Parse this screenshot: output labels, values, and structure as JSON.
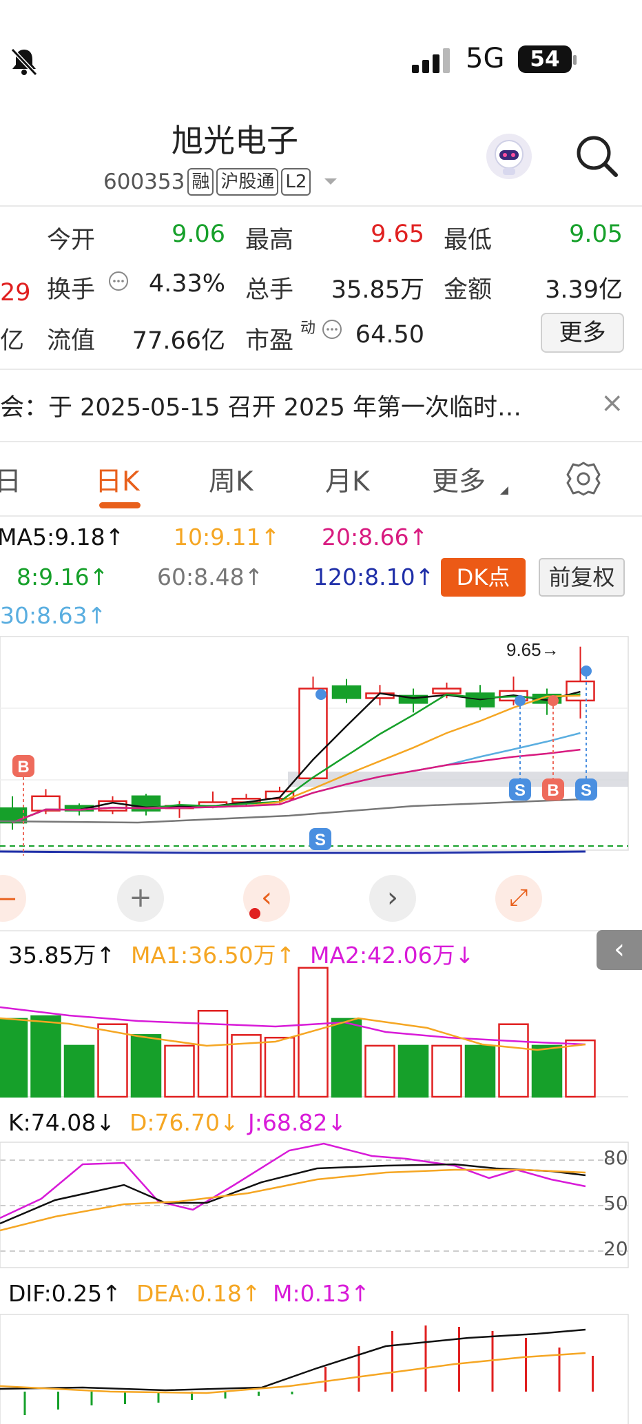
{
  "status": {
    "network": "5G",
    "battery": "54",
    "icons": [
      "bell-off-icon",
      "signal-icon"
    ]
  },
  "header": {
    "title": "旭光电子",
    "code": "600353",
    "tags": [
      "融",
      "沪股通",
      "L2"
    ],
    "icons": [
      "robot-avatar-icon",
      "search-icon",
      "dropdown-triangle-icon"
    ]
  },
  "quote": {
    "open_label": "今开",
    "open": "9.06",
    "high_label": "最高",
    "high": "9.65",
    "low_label": "最低",
    "low": "9.05",
    "turnover_label": "换手",
    "turnover": "4.33%",
    "volume_label": "总手",
    "volume": "35.85万",
    "amount_label": "金额",
    "amount": "3.39亿",
    "float_label": "流值",
    "float_cap": "77.66亿",
    "pe_label": "市盈",
    "pe_super": "动",
    "pe": "64.50",
    "more": "更多",
    "left_partial_1": "29",
    "left_partial_2": "亿"
  },
  "notice": {
    "text": "会：于 2025-05-15 召开 2025 年第一次临时…",
    "close": "×"
  },
  "tabs": [
    "日",
    "日K",
    "周K",
    "月K",
    "更多"
  ],
  "ma": {
    "ma5": "MA5:9.18↑",
    "ma10": "10:9.11↑",
    "ma20": "20:8.66↑",
    "ma8": "8:9.16↑",
    "ma60": "60:8.48↑",
    "ma120": "120:8.10↑",
    "ma30": "30:8.63↑",
    "dk_button": "DK点",
    "adjust_button": "前复权"
  },
  "colors": {
    "up": "#e02020",
    "down": "#16a02a",
    "accent": "#e8601c",
    "ma5": "#111111",
    "ma10": "#f5a623",
    "ma20": "#d81b80",
    "ma30": "#5aaee0",
    "ma60": "#777777",
    "ma120": "#1f2fa8",
    "ma8": "#16a02a"
  },
  "chart_data": [
    {
      "type": "candlestick",
      "max_label": "9.65→",
      "markers": [
        "B",
        "S",
        "S",
        "B",
        "S"
      ],
      "candles": [
        {
          "o": 8.3,
          "c": 8.18,
          "h": 8.4,
          "l": 8.12
        },
        {
          "o": 8.28,
          "c": 8.4,
          "h": 8.46,
          "l": 8.25
        },
        {
          "o": 8.32,
          "c": 8.28,
          "h": 8.34,
          "l": 8.24
        },
        {
          "o": 8.28,
          "c": 8.36,
          "h": 8.4,
          "l": 8.25
        },
        {
          "o": 8.4,
          "c": 8.28,
          "h": 8.42,
          "l": 8.24
        },
        {
          "o": 8.3,
          "c": 8.32,
          "h": 8.36,
          "l": 8.22
        },
        {
          "o": 8.32,
          "c": 8.35,
          "h": 8.44,
          "l": 8.3
        },
        {
          "o": 8.35,
          "c": 8.38,
          "h": 8.42,
          "l": 8.32
        },
        {
          "o": 8.38,
          "c": 8.44,
          "h": 8.48,
          "l": 8.34
        },
        {
          "o": 8.55,
          "c": 9.3,
          "h": 9.4,
          "l": 8.55
        },
        {
          "o": 9.32,
          "c": 9.22,
          "h": 9.38,
          "l": 9.18
        },
        {
          "o": 9.22,
          "c": 9.26,
          "h": 9.33,
          "l": 9.16
        },
        {
          "o": 9.24,
          "c": 9.18,
          "h": 9.3,
          "l": 9.1
        },
        {
          "o": 9.26,
          "c": 9.3,
          "h": 9.35,
          "l": 9.22
        },
        {
          "o": 9.26,
          "c": 9.15,
          "h": 9.33,
          "l": 9.12
        },
        {
          "o": 9.2,
          "c": 9.28,
          "h": 9.4,
          "l": 9.16
        },
        {
          "o": 9.25,
          "c": 9.18,
          "h": 9.3,
          "l": 9.08
        },
        {
          "o": 9.2,
          "c": 9.36,
          "h": 9.65,
          "l": 9.05
        }
      ]
    },
    {
      "type": "bar",
      "name": "VOL",
      "current": "35.85万↑",
      "ma1": "MA1:36.50万↑",
      "ma2": "MA2:42.06万↓",
      "values": [
        29,
        30,
        19,
        27,
        23,
        19,
        32,
        23,
        22,
        48,
        29,
        19,
        19,
        19,
        19,
        27,
        19,
        21
      ],
      "up": [
        false,
        false,
        false,
        true,
        false,
        true,
        true,
        true,
        true,
        true,
        false,
        true,
        false,
        true,
        false,
        true,
        false,
        true
      ]
    },
    {
      "type": "line",
      "name": "KDJ",
      "k": "K:74.08↓",
      "d": "D:76.70↓",
      "j": "J:68.82↓",
      "ticks": [
        "80",
        "50",
        "20"
      ]
    },
    {
      "type": "bar",
      "name": "MACD",
      "dif": "DIF:0.25↑",
      "dea": "DEA:0.18↑",
      "m": "M:0.13↑"
    }
  ]
}
